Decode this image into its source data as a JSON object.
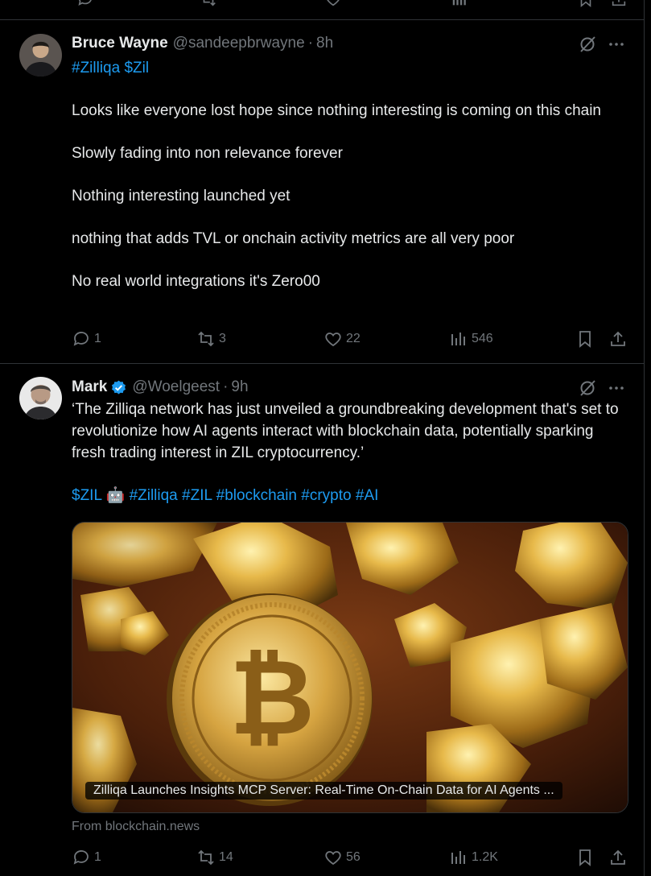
{
  "colors": {
    "background": "#000000",
    "text": "#e7e9ea",
    "muted": "#71767b",
    "link": "#1d9bf0",
    "border": "#2f3336",
    "verified": "#1d9bf0"
  },
  "tweets": [
    {
      "author": {
        "name": "Bruce Wayne",
        "handle": "@sandeepbrwayne",
        "time": "8h",
        "verified": false
      },
      "tags_line": "#Zilliqa $Zil",
      "paragraphs": [
        "Looks like everyone lost hope since nothing interesting is coming on this chain",
        "Slowly fading into non relevance forever",
        "Nothing interesting launched yet",
        "nothing that adds TVL or onchain activity metrics are all very poor",
        "No real world integrations it's Zero00"
      ],
      "stats": {
        "replies": "1",
        "reposts": "3",
        "likes": "22",
        "views": "546"
      }
    },
    {
      "author": {
        "name": "Mark",
        "handle": "@Woelgeest",
        "time": "9h",
        "verified": true
      },
      "text": "‘The Zilliqa network has just unveiled a groundbreaking development that's set to revolutionize how AI agents interact with blockchain data, potentially sparking fresh trading interest in ZIL cryptocurrency.’",
      "tags": [
        "$ZIL",
        "🤖",
        "#Zilliqa",
        "#ZIL",
        "#blockchain",
        "#crypto",
        "#AI"
      ],
      "card": {
        "image": "gold-bitcoin-image",
        "title": "Zilliqa Launches Insights MCP Server: Real-Time On-Chain Data for AI Agents ...",
        "source": "From blockchain.news"
      },
      "stats": {
        "replies": "1",
        "reposts": "14",
        "likes": "56",
        "views": "1.2K"
      }
    }
  ]
}
